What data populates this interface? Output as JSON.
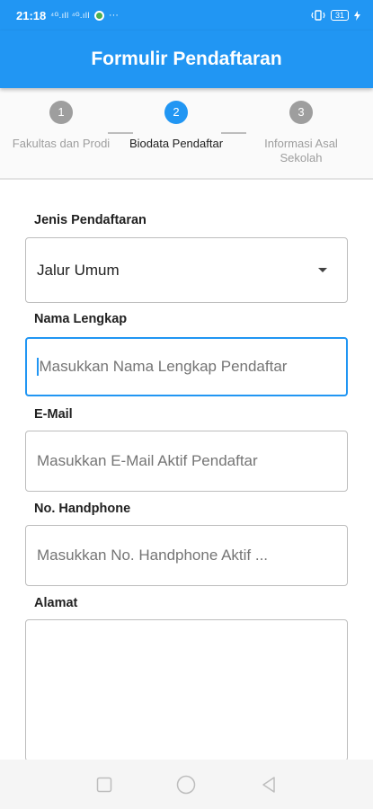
{
  "status_bar": {
    "time": "21:18",
    "signal_text": "⁴ᴳ.ıll ⁴ᴳ.ıll",
    "more": "···",
    "battery": "31",
    "icons": [
      "signal-icon",
      "whatsapp-icon",
      "vibrate-icon",
      "battery-icon",
      "charging-icon"
    ]
  },
  "app_bar": {
    "title": "Formulir Pendaftaran"
  },
  "stepper": {
    "steps": [
      {
        "number": "1",
        "label": "Fakultas dan Prodi",
        "state": "inactive"
      },
      {
        "number": "2",
        "label": "Biodata Pendaftar",
        "state": "active"
      },
      {
        "number": "3",
        "label": "Informasi Asal Sekolah",
        "state": "inactive"
      }
    ]
  },
  "form": {
    "jenis": {
      "label": "Jenis Pendaftaran",
      "value": "Jalur Umum"
    },
    "nama": {
      "label": "Nama Lengkap",
      "placeholder": "Masukkan Nama Lengkap Pendaftar"
    },
    "email": {
      "label": "E-Mail",
      "placeholder": "Masukkan E-Mail Aktif Pendaftar"
    },
    "phone": {
      "label": "No. Handphone",
      "placeholder": "Masukkan No. Handphone Aktif ..."
    },
    "alamat": {
      "label": "Alamat",
      "value": ""
    }
  },
  "colors": {
    "primary": "#2196f3",
    "inactive_step": "#9e9e9e",
    "border": "#bdbdbd"
  },
  "nav_bar": {
    "icons": [
      "recents-square-icon",
      "home-circle-icon",
      "back-triangle-icon"
    ]
  }
}
